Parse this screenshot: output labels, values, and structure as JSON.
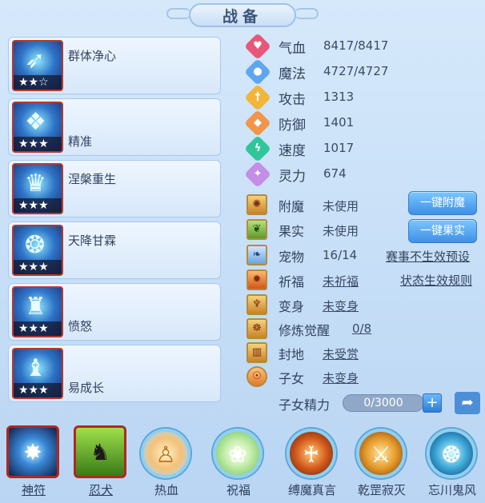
{
  "header": {
    "title": "战备"
  },
  "skills": [
    {
      "name": "群体净心",
      "stars": "★★☆",
      "icon": "bow-icon"
    },
    {
      "name": "精准",
      "stars": "★★★",
      "icon": "flame-mask-icon"
    },
    {
      "name": "涅槃重生",
      "stars": "★★★",
      "icon": "phoenix-mask-icon"
    },
    {
      "name": "天降甘霖",
      "stars": "★★★",
      "icon": "rain-mask-icon"
    },
    {
      "name": "愤怒",
      "stars": "★★★",
      "icon": "rage-mask-icon"
    },
    {
      "name": "易成长",
      "stars": "★★★",
      "icon": "growth-mask-icon"
    }
  ],
  "stats": [
    {
      "label": "气血",
      "value": "8417/8417",
      "color": "#e8577a",
      "icon": "heart-icon"
    },
    {
      "label": "魔法",
      "value": "4727/4727",
      "color": "#5fa6f0",
      "icon": "mana-icon"
    },
    {
      "label": "攻击",
      "value": "1313",
      "color": "#f2b53a",
      "icon": "sword-icon"
    },
    {
      "label": "防御",
      "value": "1401",
      "color": "#f0954a",
      "icon": "shield-icon"
    },
    {
      "label": "速度",
      "value": "1017",
      "color": "#2fc79a",
      "icon": "lightning-icon"
    },
    {
      "label": "灵力",
      "value": "674",
      "color": "#c48ee6",
      "icon": "spirit-icon"
    }
  ],
  "features": [
    {
      "label": "附魔",
      "value": "未使用",
      "icon": "enchant-icon"
    },
    {
      "label": "果实",
      "value": "未使用",
      "icon": "fruit-icon"
    },
    {
      "label": "宠物",
      "value": "16/14",
      "icon": "pet-icon"
    },
    {
      "label": "祈福",
      "value": "未祈福",
      "icon": "pray-icon"
    },
    {
      "label": "变身",
      "value": "未变身",
      "icon": "transform-icon"
    },
    {
      "label": "修炼觉醒",
      "value": "0/8",
      "icon": "cultivate-icon"
    },
    {
      "label": "封地",
      "value": "未受赏",
      "icon": "fief-icon"
    },
    {
      "label": "子女",
      "value": "未变身",
      "icon": "child-icon"
    }
  ],
  "buttons": {
    "enchant": "一键附魔",
    "fruit": "一键果实",
    "preset": "赛事不生效预设",
    "rules": "状态生效规则"
  },
  "energy": {
    "label": "子女精力",
    "value": "0/3000",
    "fraction": 0.0
  },
  "bottom": [
    {
      "label": "神符",
      "style": "square",
      "icon": "rune-icon",
      "underline": true
    },
    {
      "label": "忍犬",
      "style": "square",
      "icon": "wolf-icon",
      "underline": true
    },
    {
      "label": "热血",
      "style": "circle",
      "icon": "warrior-icon",
      "underline": false
    },
    {
      "label": "祝福",
      "style": "circle",
      "icon": "blessing-icon",
      "underline": false
    },
    {
      "label": "缚魔真言",
      "style": "circle",
      "icon": "demon-bind-icon",
      "underline": false
    },
    {
      "label": "乾罡寂灭",
      "style": "circle",
      "icon": "spear-icon",
      "underline": false
    },
    {
      "label": "忘川鬼风",
      "style": "circle",
      "icon": "ghost-wind-icon",
      "underline": false
    }
  ]
}
